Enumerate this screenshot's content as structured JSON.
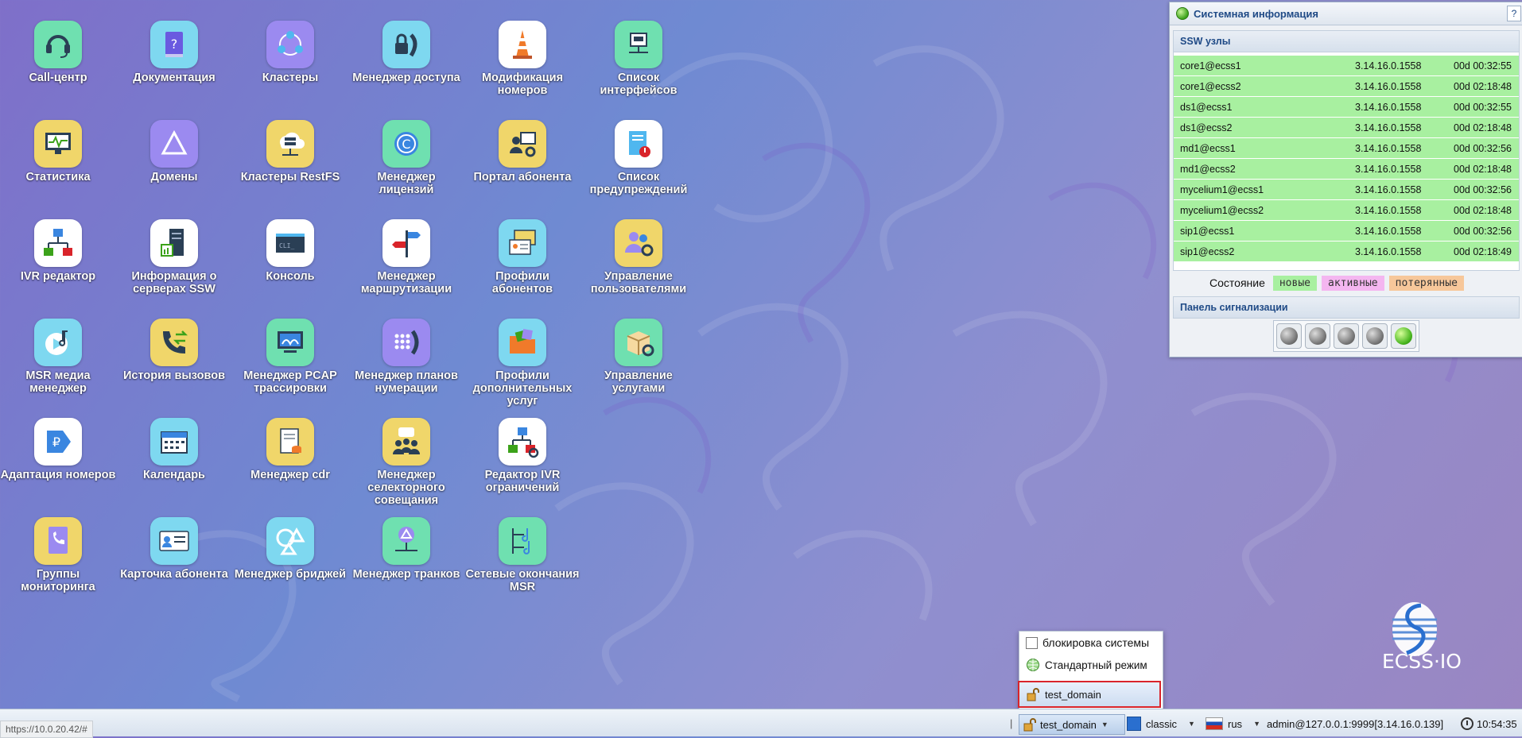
{
  "desktop": {
    "icons": [
      {
        "label": "Call-центр",
        "icon": "headset-icon"
      },
      {
        "label": "Документация",
        "icon": "help-book-icon"
      },
      {
        "label": "Кластеры",
        "icon": "cluster-icon"
      },
      {
        "label": "Менеджер доступа",
        "icon": "lock-phone-icon"
      },
      {
        "label": "Модификация номеров",
        "icon": "traffic-cone-icon"
      },
      {
        "label": "Список интерфейсов",
        "icon": "network-interface-icon"
      },
      {
        "label": "Статистика",
        "icon": "monitor-graph-icon"
      },
      {
        "label": "Домены",
        "icon": "triangle-icon"
      },
      {
        "label": "Кластеры RestFS",
        "icon": "cloud-server-icon"
      },
      {
        "label": "Менеджер лицензий",
        "icon": "copyright-icon"
      },
      {
        "label": "Портал абонента",
        "icon": "user-portal-icon"
      },
      {
        "label": "Список предупреждений",
        "icon": "warning-list-icon"
      },
      {
        "label": "IVR редактор",
        "icon": "flowchart-icon"
      },
      {
        "label": "Информация о серверах SSW",
        "icon": "server-info-icon"
      },
      {
        "label": "Консоль",
        "icon": "console-icon"
      },
      {
        "label": "Менеджер маршрутизации",
        "icon": "signpost-icon"
      },
      {
        "label": "Профили абонентов",
        "icon": "profile-cards-icon"
      },
      {
        "label": "Управление пользователями",
        "icon": "users-settings-icon"
      },
      {
        "label": "MSR медиа менеджер",
        "icon": "media-note-icon"
      },
      {
        "label": "История вызовов",
        "icon": "call-history-icon"
      },
      {
        "label": "Менеджер PCAP трассировки",
        "icon": "pcap-monitor-icon"
      },
      {
        "label": "Менеджер планов нумерации",
        "icon": "dialpad-icon"
      },
      {
        "label": "Профили дополнительных услуг",
        "icon": "folder-services-icon"
      },
      {
        "label": "Управление услугами",
        "icon": "box-services-icon"
      },
      {
        "label": "Адаптация номеров",
        "icon": "ruble-tag-icon"
      },
      {
        "label": "Календарь",
        "icon": "calendar-icon"
      },
      {
        "label": "Менеджер cdr",
        "icon": "cdr-document-icon"
      },
      {
        "label": "Менеджер селекторного совещания",
        "icon": "conference-icon"
      },
      {
        "label": "Редактор IVR ограничений",
        "icon": "ivr-restrictions-icon"
      },
      {
        "label": "",
        "icon": ""
      },
      {
        "label": "Группы мониторинга",
        "icon": "monitoring-phonebook-icon"
      },
      {
        "label": "Карточка абонента",
        "icon": "subscriber-card-icon"
      },
      {
        "label": "Менеджер бриджей",
        "icon": "bridge-shapes-icon"
      },
      {
        "label": "Менеджер транков",
        "icon": "trunk-icon"
      },
      {
        "label": "Сетевые окончания MSR",
        "icon": "network-endpoints-icon"
      }
    ]
  },
  "sysinfo": {
    "title": "Системная информация",
    "help": "?",
    "nodes_header": "SSW узлы",
    "nodes": [
      {
        "name": "core1@ecss1",
        "version": "3.14.16.0.1558",
        "uptime": "00d 00:32:55"
      },
      {
        "name": "core1@ecss2",
        "version": "3.14.16.0.1558",
        "uptime": "00d 02:18:48"
      },
      {
        "name": "ds1@ecss1",
        "version": "3.14.16.0.1558",
        "uptime": "00d 00:32:55"
      },
      {
        "name": "ds1@ecss2",
        "version": "3.14.16.0.1558",
        "uptime": "00d 02:18:48"
      },
      {
        "name": "md1@ecss1",
        "version": "3.14.16.0.1558",
        "uptime": "00d 00:32:56"
      },
      {
        "name": "md1@ecss2",
        "version": "3.14.16.0.1558",
        "uptime": "00d 02:18:48"
      },
      {
        "name": "mycelium1@ecss1",
        "version": "3.14.16.0.1558",
        "uptime": "00d 00:32:56"
      },
      {
        "name": "mycelium1@ecss2",
        "version": "3.14.16.0.1558",
        "uptime": "00d 02:18:48"
      },
      {
        "name": "sip1@ecss1",
        "version": "3.14.16.0.1558",
        "uptime": "00d 00:32:56"
      },
      {
        "name": "sip1@ecss2",
        "version": "3.14.16.0.1558",
        "uptime": "00d 02:18:49"
      }
    ],
    "state_label": "Состояние",
    "state_new": "новые",
    "state_active": "активные",
    "state_lost": "потерянные",
    "alarm_header": "Панель сигнализации",
    "alarm_lamps": [
      "off",
      "off",
      "off",
      "off",
      "on"
    ],
    "colors": {
      "new": "#a8f0a0",
      "active": "#f4b6f0",
      "lost": "#f7c79a"
    }
  },
  "popup": {
    "lock_label": "блокировка системы",
    "mode_label": "Стандартный режим",
    "domain_label": "test_domain"
  },
  "logo": {
    "text": "ECSS·IO"
  },
  "taskbar": {
    "url_status": "https://10.0.20.42/#",
    "separator": "|",
    "domain": "test_domain",
    "theme": "classic",
    "lang": "rus",
    "user": "admin@127.0.0.1:9999[3.14.16.0.139]",
    "time": "10:54:35"
  }
}
